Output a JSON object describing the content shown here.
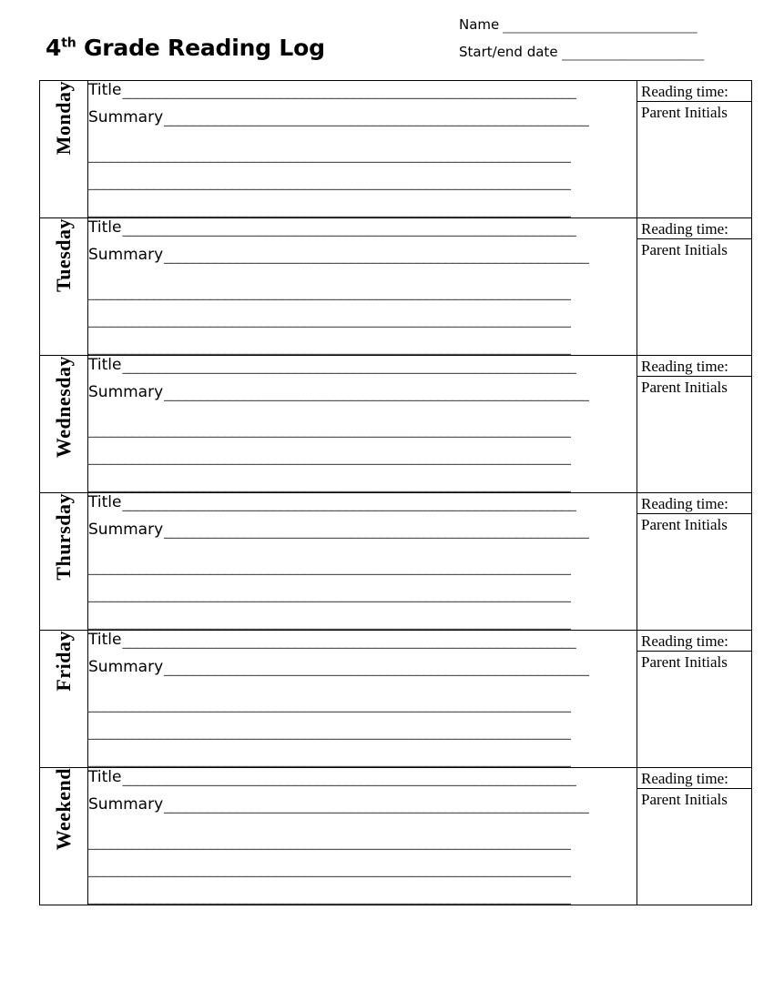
{
  "document": {
    "title_grade": "4",
    "title_ordinal": "th",
    "title_rest": " Grade Reading Log"
  },
  "header": {
    "fields": [
      {
        "label": "Name",
        "rule": "______________________________",
        "value": ""
      },
      {
        "label": "Start/end date",
        "rule": "______________________",
        "value": ""
      }
    ]
  },
  "table": {
    "entry_labels": {
      "title": "Title",
      "summary": "Summary"
    },
    "rules": {
      "title": "_______________________________________________________________",
      "summary": "___________________________________________________________",
      "blank": "___________________________________________________________________"
    },
    "side_labels": {
      "reading_time": "Reading time:",
      "parent_initials": "Parent Initials"
    },
    "blank_lines_per_row": 3,
    "rows": [
      {
        "day": "Monday"
      },
      {
        "day": "Tuesday"
      },
      {
        "day": "Wednesday"
      },
      {
        "day": "Thursday"
      },
      {
        "day": "Friday"
      },
      {
        "day": "Weekend"
      }
    ]
  },
  "colors": {
    "text": "#000000",
    "rule": "#555555",
    "border": "#000000",
    "background": "#ffffff"
  }
}
